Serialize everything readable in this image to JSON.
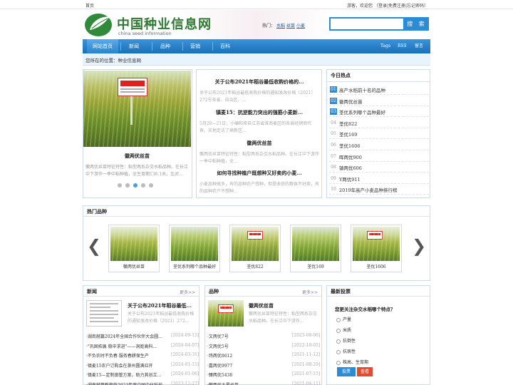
{
  "topbar": {
    "home": "首页",
    "user_links": "游客，欢迎您 （登录|免费注册|忘记密码）"
  },
  "logo": {
    "cn": "中国种业信息网",
    "en": "china seed information"
  },
  "hot": {
    "label": "热门：",
    "words": [
      "水稻",
      "丝苗",
      "小麦"
    ]
  },
  "search": {
    "placeholder": "",
    "button": "搜 索"
  },
  "nav": {
    "items": [
      "网站首页",
      "新闻",
      "品种",
      "营销",
      "百科"
    ],
    "right": [
      "Tags",
      "RSS",
      "留言"
    ]
  },
  "breadcrumb": "您所在的位置：种业信息网",
  "slider": {
    "title": "徽两优丝苗",
    "text": "徽两优丝苗特征特性：籼型两系杂交水稻品种。在长江中下游作一季中稻种植，全生育期136.1天，比对...",
    "dot_count": 5,
    "active_dot": 2
  },
  "center_news": [
    {
      "title": "关于公布2021年稻谷最低收购价格的...",
      "desc": "关于公布2021年稻谷最低收购价格的通知发改价格〔2021〕272号各省、自治区、..."
    },
    {
      "title": "镇麦15：抗逆能力突出的强筋小麦新...",
      "desc": "5月20—21日，小编和来自江苏省淮南麦区的各县经销商代表，实地走访了高新区..."
    },
    {
      "title": "徽两优丝苗",
      "desc": "徽两优丝苗特征特性：籼型两系杂交水稻品种。在长江中下游作一季中稻种植，全..."
    },
    {
      "title": "如何寻找种植户既想种又好卖的小麦...",
      "desc": "小麦品种很多，有的品种农户想种，但是收获的粮食不好卖，有的品种农户不想种..."
    }
  ],
  "today_hot": {
    "title": "今日热点",
    "items": [
      {
        "num": "01",
        "text": "高产水稻前十名的品种",
        "top": true
      },
      {
        "num": "02",
        "text": "徽两优丝苗",
        "top": true
      },
      {
        "num": "03",
        "text": "荃优系列哪个品种最好",
        "top": true
      },
      {
        "num": "04",
        "text": "荃优822",
        "top": false
      },
      {
        "num": "05",
        "text": "荃优169",
        "top": false
      },
      {
        "num": "06",
        "text": "荃优1606",
        "top": false
      },
      {
        "num": "07",
        "text": "晖两优900",
        "top": false
      },
      {
        "num": "08",
        "text": "镇两优606",
        "top": false
      },
      {
        "num": "09",
        "text": "Y两优911",
        "top": false
      },
      {
        "num": "10",
        "text": "2019年高产小麦品种排行榜",
        "top": false
      }
    ]
  },
  "hot_varieties": {
    "title": "热门品种",
    "cards": [
      "徽两优丝苗",
      "荃优系列哪个品种最好",
      "荃优822",
      "荃优169",
      "荃优1606"
    ],
    "prev_icon": "chevron-left-icon",
    "next_icon": "chevron-right-icon"
  },
  "news": {
    "title": "新闻",
    "more": "更多>>",
    "feature_title": "关于公布2021年稻谷最低...",
    "feature_desc": "关于公布2021年稻谷最低收购价格的通知发改价格〔2021〕272...",
    "rows": [
      {
        "text": "·湖南赫篇2024年全国合作伙伴大会圆...",
        "date": "[2024-09-15]"
      },
      {
        "text": "·\"巩固拓展 稳中求进\"——洞庭高科...",
        "date": "[2024-04-07]"
      },
      {
        "text": "·不负农时不负春 服务春耕保生产",
        "date": "[2024-03-31]"
      },
      {
        "text": "·镇麦15农户订购会在滁州圆满召开",
        "date": "[2024-01-15]"
      },
      {
        "text": "·镇麦15—定制田管方案，助力其创立...",
        "date": "[2024-01-06]"
      },
      {
        "text": "·湖南赫篇新荣获2023年度中国中化科技...",
        "date": "[2023-12-27]"
      }
    ]
  },
  "varieties": {
    "title": "品种",
    "more": "更多>>",
    "feature_title": "徽两优丝苗",
    "feature_desc": "徽两优丝苗特征特性：籼型两系杂交水稻品种。在长江中下游作...",
    "rows": [
      {
        "text": "·文两优7号",
        "date": "[2023-08-06]"
      },
      {
        "text": "·文两优5号",
        "date": "[2022-10-05]"
      },
      {
        "text": "·玮两优8612",
        "date": "[2021-11-12]"
      },
      {
        "text": "·嘉两优9977",
        "date": "[2021-08-29]"
      },
      {
        "text": "·臻两优5438",
        "date": "[2021-07-15]"
      },
      {
        "text": "·徽两优五星丝苗",
        "date": "[2021-04-11]"
      }
    ]
  },
  "poll": {
    "title": "最新投票",
    "question": "您更关注杂交水稻哪个特点？",
    "options": [
      "产量",
      "米质",
      "抗倒性",
      "抗病性",
      "株高、生育期"
    ],
    "vote": "投票",
    "view": "查看"
  },
  "colors": {
    "accent": "#2a8bd6",
    "nav": "#1c6fb8",
    "logo_green": "#2f7a33",
    "view_btn": "#e34b2c"
  }
}
